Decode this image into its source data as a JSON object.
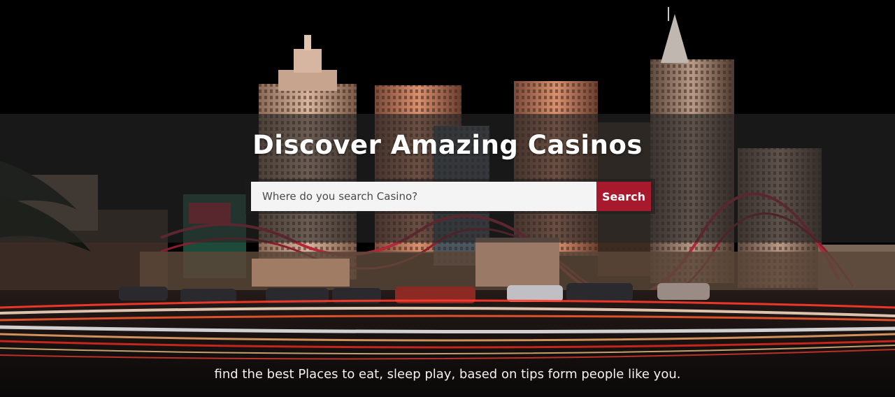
{
  "hero": {
    "title": "Discover Amazing Casinos",
    "tagline": "find the best Places to eat, sleep play, based on tips form people like you."
  },
  "search": {
    "placeholder": "Where do you search Casino?",
    "value": "",
    "button_label": "Search"
  },
  "colors": {
    "accent": "#a8192e",
    "background": "#000000"
  }
}
